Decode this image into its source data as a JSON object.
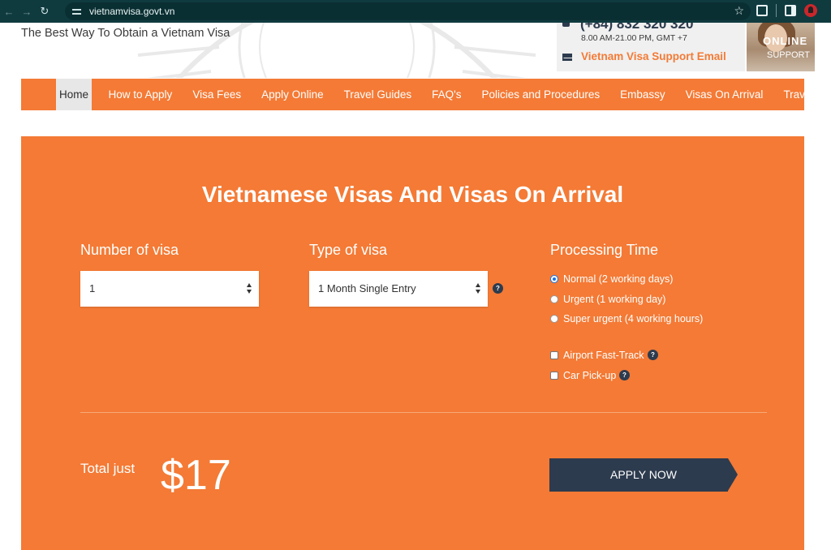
{
  "browser": {
    "url": "vietnamvisa.govt.vn",
    "back_icon": "arrow-left-icon",
    "forward_icon": "arrow-right-icon",
    "reload_icon": "reload-icon",
    "bookmark_icon": "star-icon"
  },
  "header": {
    "tagline": "The Best Way To Obtain a Vietnam Visa",
    "phone": "(+84) 832 320 320",
    "hours": "8.00 AM-21.00 PM, GMT +7",
    "email_label": "Vietnam Visa Support Email",
    "support_title": "ONLINE",
    "support_sub": "SUPPORT"
  },
  "nav": {
    "items": [
      {
        "label": "Home"
      },
      {
        "label": "How to Apply"
      },
      {
        "label": "Visa Fees"
      },
      {
        "label": "Apply Online"
      },
      {
        "label": "Travel Guides"
      },
      {
        "label": "FAQ's"
      },
      {
        "label": "Policies and Procedures"
      },
      {
        "label": "Embassy"
      },
      {
        "label": "Visas On Arrival"
      },
      {
        "label": "Travel Tips"
      }
    ]
  },
  "form": {
    "title": "Vietnamese Visas And Visas On Arrival",
    "number_label": "Number of visa",
    "number_value": "1",
    "type_label": "Type of visa",
    "type_value": "1 Month Single Entry",
    "processing_label": "Processing Time",
    "processing_options": [
      {
        "label": "Normal (2 working days)",
        "checked": true
      },
      {
        "label": "Urgent (1 working day)",
        "checked": false
      },
      {
        "label": "Super urgent (4 working hours)",
        "checked": false
      }
    ],
    "extras": [
      {
        "label": "Airport Fast-Track",
        "checked": false
      },
      {
        "label": "Car Pick-up",
        "checked": false
      }
    ],
    "help_glyph": "?",
    "total_label": "Total just",
    "total_price": "$17",
    "apply_label": "APPLY NOW"
  },
  "colors": {
    "brand_orange": "#f47a35",
    "navy": "#2d3b4e",
    "browser_bar": "#0f3b3f"
  }
}
